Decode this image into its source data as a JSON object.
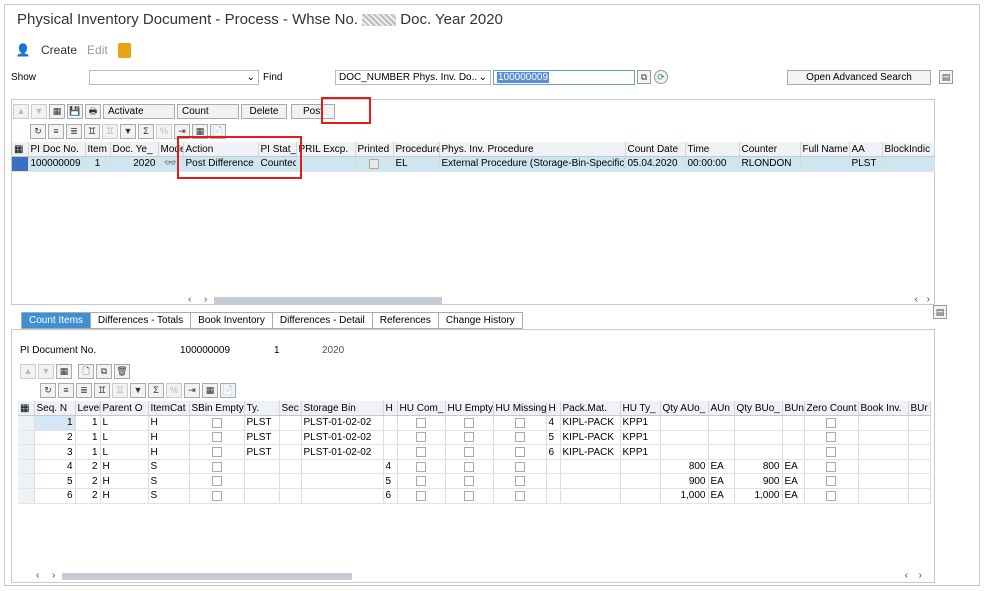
{
  "title": "Physical Inventory Document - Process - Whse No.",
  "title_suffix": "Doc. Year 2020",
  "toolbar": {
    "create": "Create",
    "edit": "Edit"
  },
  "search": {
    "show_label": "Show",
    "find_label": "Find",
    "find_field": "DOC_NUMBER Phys. Inv. Do..",
    "find_value": "100000009",
    "advanced": "Open Advanced Search"
  },
  "actions": {
    "activate": "Activate",
    "count": "Count",
    "delete": "Delete",
    "post": "Post"
  },
  "doc_table": {
    "headers": [
      "PI Doc No.",
      "Item",
      "Doc. Ye_",
      "Mode",
      "Action",
      "PI Stat_",
      "PRIL Excp.",
      "Printed",
      "Procedure",
      "Phys. Inv. Procedure",
      "Count Date",
      "Time",
      "Counter",
      "Full Name",
      "AA",
      "BlockIndic"
    ],
    "rows": [
      [
        "100000009",
        "1",
        "2020",
        "👓",
        "Post Difference",
        "Counted",
        "",
        "",
        "EL",
        "External Procedure (Storage-Bin-Specific)",
        "05.04.2020",
        "00:00:00",
        "RLONDON",
        "",
        "PLST",
        ""
      ]
    ]
  },
  "tabs": [
    "Count Items",
    "Differences - Totals",
    "Book Inventory",
    "Differences - Detail",
    "References",
    "Change History"
  ],
  "detail": {
    "label": "PI Document No.",
    "doc": "100000009",
    "item": "1",
    "year": "2020"
  },
  "items_table": {
    "headers": [
      "Seq. N",
      "Level",
      "Parent O",
      "ItemCat",
      "SBin Empty",
      "Ty.",
      "Sec",
      "Storage Bin",
      "H",
      "HU Com_",
      "HU Empty",
      "HU Missing",
      "H",
      "Pack.Mat.",
      "HU Ty_",
      "Qty AUo_",
      "AUn",
      "Qty BUo_",
      "BUn",
      "Zero Count",
      "Book Inv.",
      "BUr"
    ],
    "rows": [
      [
        "1",
        "1",
        "L",
        "H",
        "",
        "PLST",
        "",
        "PLST-01-02-02",
        "",
        "",
        "",
        "",
        "4",
        "KIPL-PACK",
        "KPP1",
        "",
        "",
        "",
        "",
        "",
        "",
        ""
      ],
      [
        "2",
        "1",
        "L",
        "H",
        "",
        "PLST",
        "",
        "PLST-01-02-02",
        "",
        "",
        "",
        "",
        "5",
        "KIPL-PACK",
        "KPP1",
        "",
        "",
        "",
        "",
        "",
        "",
        ""
      ],
      [
        "3",
        "1",
        "L",
        "H",
        "",
        "PLST",
        "",
        "PLST-01-02-02",
        "",
        "",
        "",
        "",
        "6",
        "KIPL-PACK",
        "KPP1",
        "",
        "",
        "",
        "",
        "",
        "",
        ""
      ],
      [
        "4",
        "2",
        "H",
        "S",
        "",
        "",
        "",
        "",
        "4",
        "",
        "",
        "",
        "",
        "",
        "",
        "800",
        "EA",
        "800",
        "EA",
        "",
        "",
        ""
      ],
      [
        "5",
        "2",
        "H",
        "S",
        "",
        "",
        "",
        "",
        "5",
        "",
        "",
        "",
        "",
        "",
        "",
        "900",
        "EA",
        "900",
        "EA",
        "",
        "",
        ""
      ],
      [
        "6",
        "2",
        "H",
        "S",
        "",
        "",
        "",
        "",
        "6",
        "",
        "",
        "",
        "",
        "",
        "",
        "1,000",
        "EA",
        "1,000",
        "EA",
        "",
        "",
        ""
      ]
    ]
  }
}
